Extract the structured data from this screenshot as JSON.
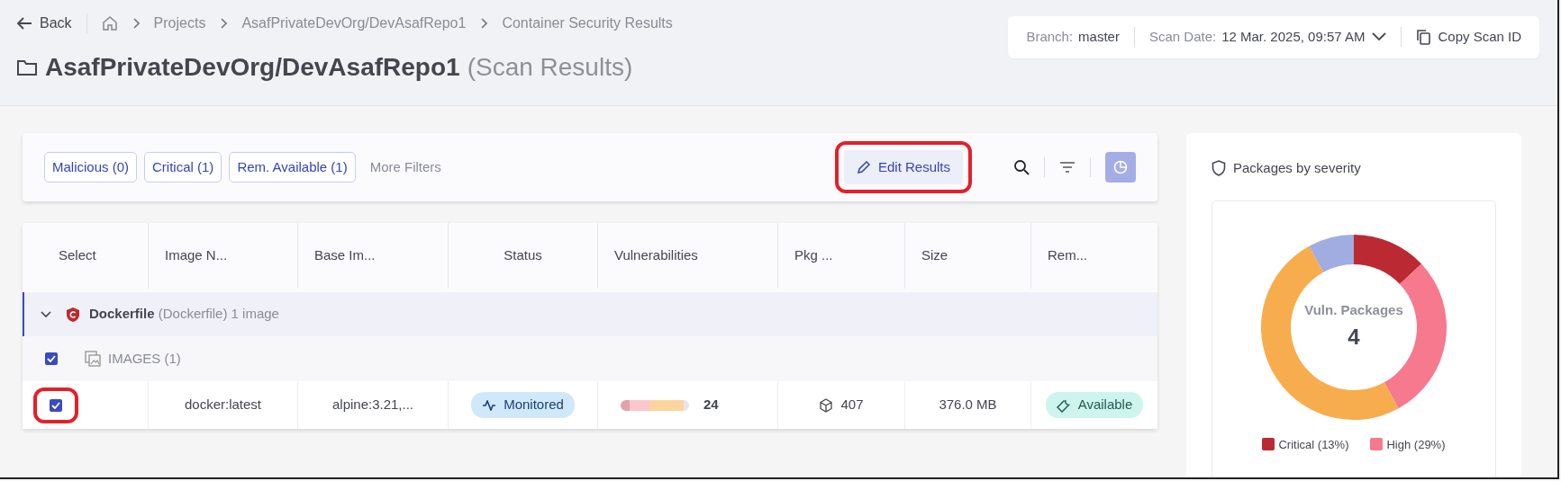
{
  "header": {
    "back": "Back",
    "breadcrumbs": [
      "Projects",
      "AsafPrivateDevOrg/DevAsafRepo1",
      "Container Security Results"
    ],
    "title": "AsafPrivateDevOrg/DevAsafRepo1",
    "subtitle": "(Scan Results)"
  },
  "scan_info": {
    "branch_label": "Branch:",
    "branch": "master",
    "date_label": "Scan Date:",
    "date": "12 Mar. 2025, 09:57 AM",
    "copy": "Copy Scan ID"
  },
  "filters": [
    {
      "label": "Malicious (0)"
    },
    {
      "label": "Critical (1)"
    },
    {
      "label": "Rem. Available (1)"
    }
  ],
  "more_filters": "More Filters",
  "edit_button": {
    "label": "Edit Results",
    "highlighted": true
  },
  "chart_toggle": {
    "on": true
  },
  "table": {
    "columns": [
      "Select",
      "Image N...",
      "Base Im...",
      "Status",
      "Vulnerabilities",
      "Pkg ...",
      "Size",
      "Rem..."
    ],
    "group": {
      "name": "Dockerfile",
      "type": "(Dockerfile)",
      "count": "1 image",
      "expanded": true
    },
    "section": {
      "label": "IMAGES (1)",
      "checked": true
    },
    "rows": [
      {
        "checked": true,
        "highlighted": true,
        "image": "docker:latest",
        "base": "alpine:3.21,...",
        "status": "Monitored",
        "vuln_bar": [
          {
            "color": "#e3a1a9"
          },
          {
            "color": "#fbc7cd"
          },
          {
            "color": "#fdd49d"
          },
          {
            "color": "#e5e7ef"
          }
        ],
        "vulnerabilities": "24",
        "packages": "407",
        "size": "376.0 MB",
        "remediation": "Available"
      }
    ]
  },
  "severity_panel": {
    "title": "Packages by severity",
    "center_label": "Vuln. Packages",
    "center_value": "4",
    "slices": [
      {
        "color": "#bb2a33"
      },
      {
        "color": "#f7798e"
      },
      {
        "color": "#f7ad4d"
      },
      {
        "color": "#a1ace0"
      }
    ],
    "legend": [
      {
        "label": "Critical (13%)",
        "color": "#bb2a33"
      },
      {
        "label": "High (29%)",
        "color": "#f7798e"
      }
    ]
  }
}
